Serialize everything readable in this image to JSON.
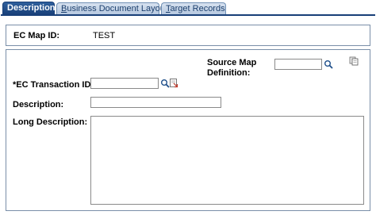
{
  "tabs": [
    {
      "label": "Description",
      "accesskey": "",
      "active": true
    },
    {
      "label": "Business Document Layout",
      "accesskey": "B",
      "active": false
    },
    {
      "label": "Target Records",
      "accesskey": "T",
      "active": false
    }
  ],
  "header": {
    "map_id_label": "EC Map ID:",
    "map_id_value": "TEST"
  },
  "form": {
    "source_map_label_line1": "Source Map",
    "source_map_label_line2": "Definition:",
    "source_map_value": "",
    "transaction_label": "*EC Transaction ID:",
    "transaction_value": "",
    "description_label": "Description:",
    "description_value": "",
    "long_description_label": "Long Description:",
    "long_description_value": ""
  },
  "icons": {
    "lookup": "magnifier-icon",
    "copy": "copy-pages-icon",
    "detail": "detail-page-icon"
  },
  "colors": {
    "tab_active": "#183f78",
    "tab_inactive": "#c6d5e8",
    "tab_text": "#1c3f6d",
    "border": "#7a8fa8"
  }
}
